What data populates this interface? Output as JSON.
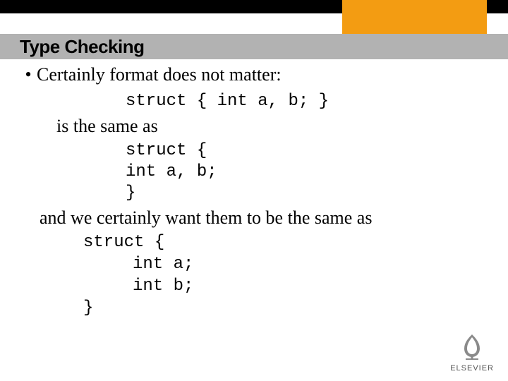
{
  "header": {
    "title": "Type Checking"
  },
  "bullet": {
    "marker": "•",
    "text": "Certainly format does not matter:"
  },
  "code1": "struct { int a, b; }",
  "line_same": "is the same as",
  "code2": {
    "l1": "struct {",
    "l2": "int a, b;",
    "l3": "}"
  },
  "line_and": "and we certainly want them to be the same as",
  "code3": {
    "l1": "struct {",
    "l2": "int a;",
    "l3": "int b;",
    "l4": "}"
  },
  "logo": {
    "text": "ELSEVIER"
  }
}
